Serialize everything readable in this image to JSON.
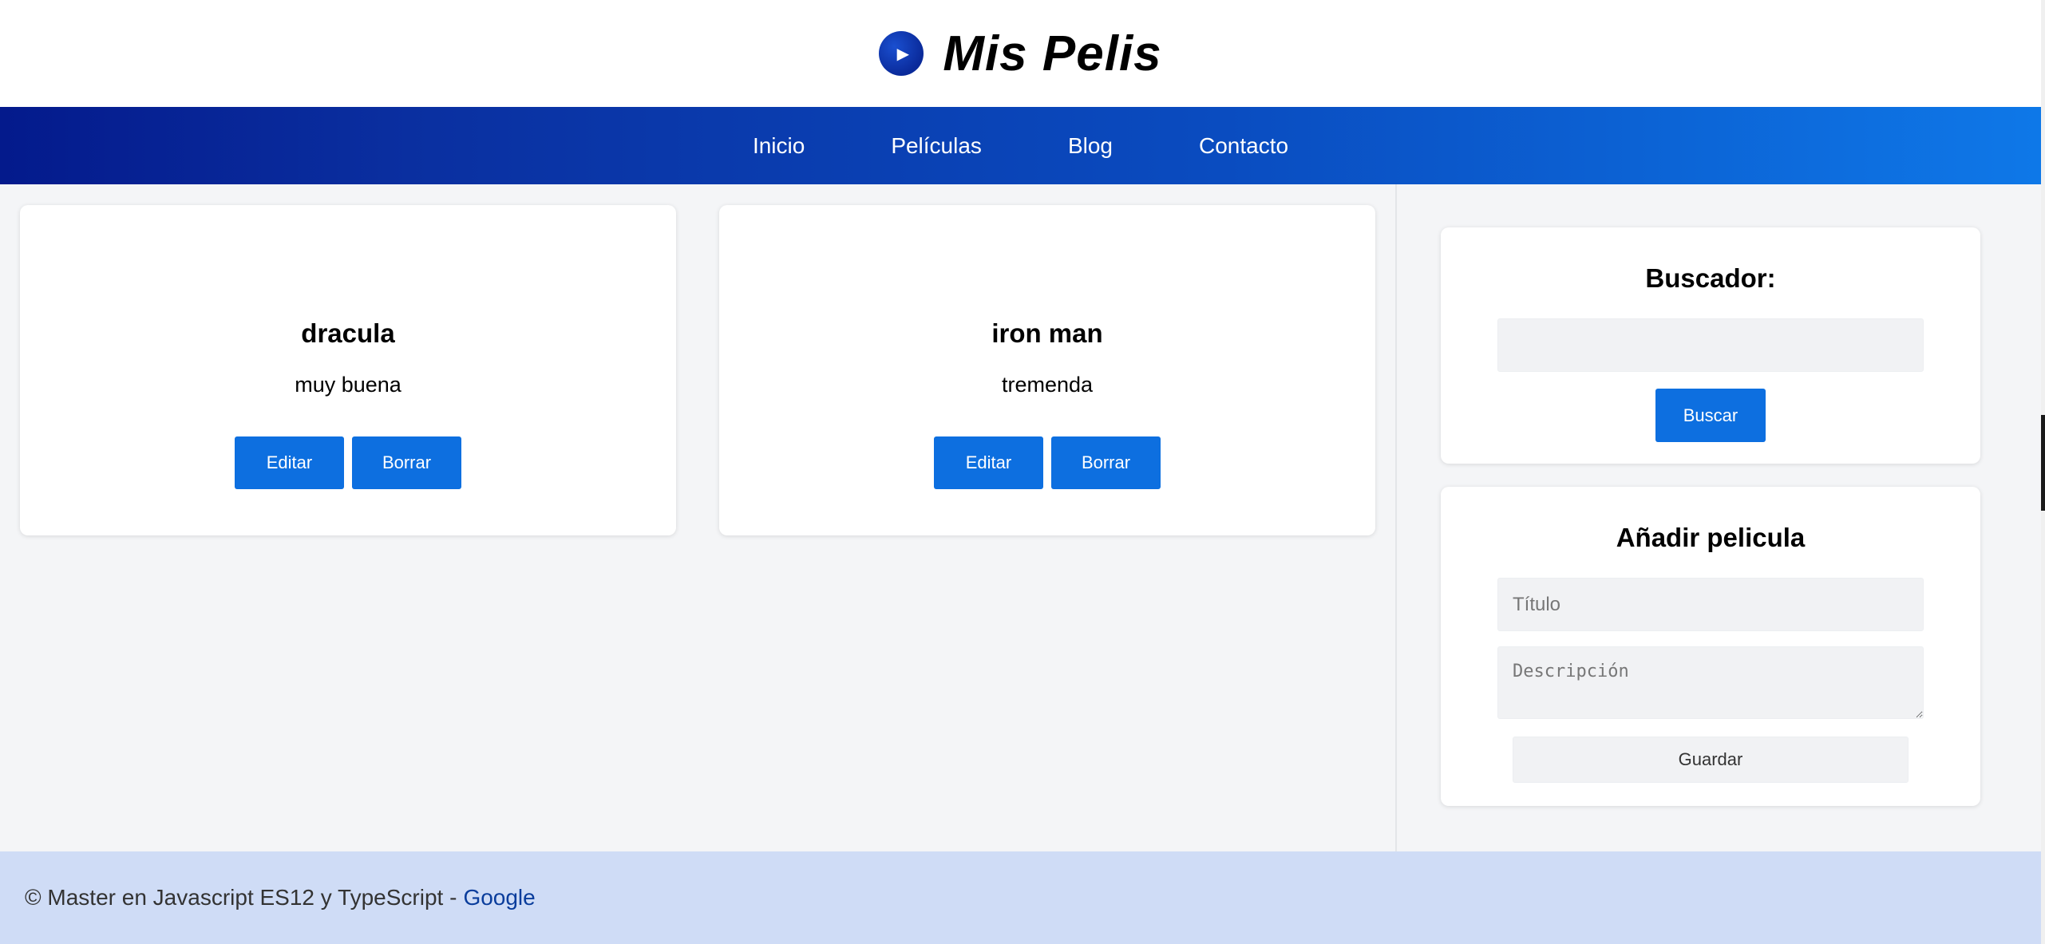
{
  "header": {
    "brand": "Mis Pelis",
    "logo_icon": "play-icon"
  },
  "nav": {
    "items": [
      "Inicio",
      "Películas",
      "Blog",
      "Contacto"
    ]
  },
  "movies": [
    {
      "title": "dracula",
      "description": "muy buena",
      "edit_label": "Editar",
      "delete_label": "Borrar"
    },
    {
      "title": "iron man",
      "description": "tremenda",
      "edit_label": "Editar",
      "delete_label": "Borrar"
    }
  ],
  "search": {
    "heading": "Buscador:",
    "value": "",
    "button_label": "Buscar"
  },
  "add_movie": {
    "heading": "Añadir pelicula",
    "title_placeholder": "Título",
    "description_placeholder": "Descripción",
    "save_label": "Guardar"
  },
  "footer": {
    "text": "© Master en Javascript ES12 y TypeScript -",
    "link_text": "Google"
  },
  "colors": {
    "nav_start": "#041a8c",
    "nav_end": "#0e78e8",
    "button": "#0d6fe0",
    "footer_bg": "#cfdcf6"
  }
}
